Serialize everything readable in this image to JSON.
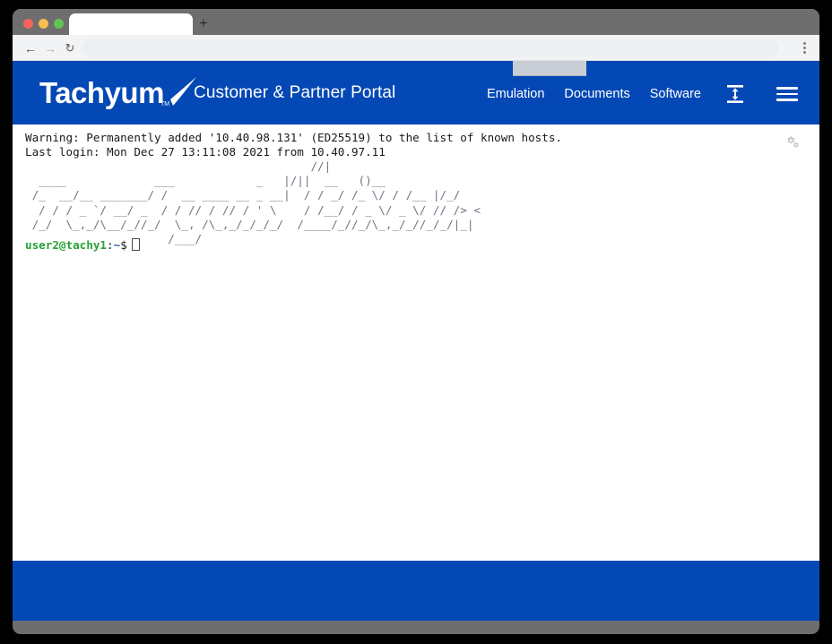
{
  "browser": {
    "traffic_lights": [
      "close",
      "minimize",
      "maximize"
    ],
    "tab_title": "",
    "new_tab_label": "+",
    "back_icon": "←",
    "forward_icon": "→",
    "reload_icon": "↻",
    "url_value": "",
    "url_placeholder": "",
    "menu_icon": "kebab-menu"
  },
  "header": {
    "brand_word": "Tachyum",
    "brand_tm": "TM",
    "title": "Customer & Partner Portal",
    "accent_color": "#0448b5",
    "nav": [
      {
        "label": "Emulation"
      },
      {
        "label": "Documents"
      },
      {
        "label": "Software"
      }
    ],
    "fit_icon": "fit-height-icon",
    "menu_icon": "hamburger-icon"
  },
  "terminal": {
    "settings_icon": "gears-icon",
    "lines": [
      "Warning: Permanently added '10.40.98.131' (ED25519) to the list of known hosts.",
      "Last login: Mon Dec 27 13:11:08 2021 from 10.40.97.11"
    ],
    "ascii_banner": "                                          //|\n  ____             ___            _   |/||  __   ()__\n /_  __/__ _______/ /  __ ____ __ _ __|  / / _/ /_ \\/ / /__ |/_/\n  / / / _ `/ __/ _  / / // / // / ' \\    / /__/ / _ \\/ _ \\/ // /> <\n /_/  \\_,_/\\__/_//_/  \\_, /\\_,_/_/_/_/  /____/_//_/\\_,_/_//_/_/|_|\n                     /___/",
    "prompt": {
      "user_host": "user2@tachy1",
      "separator": ":",
      "path": "~",
      "symbol": "$",
      "command": ""
    },
    "text_color": "#1a1a1a",
    "ascii_color": "#6d7684",
    "user_color": "#26a236"
  },
  "footer": {
    "background_color": "#0448b5"
  }
}
